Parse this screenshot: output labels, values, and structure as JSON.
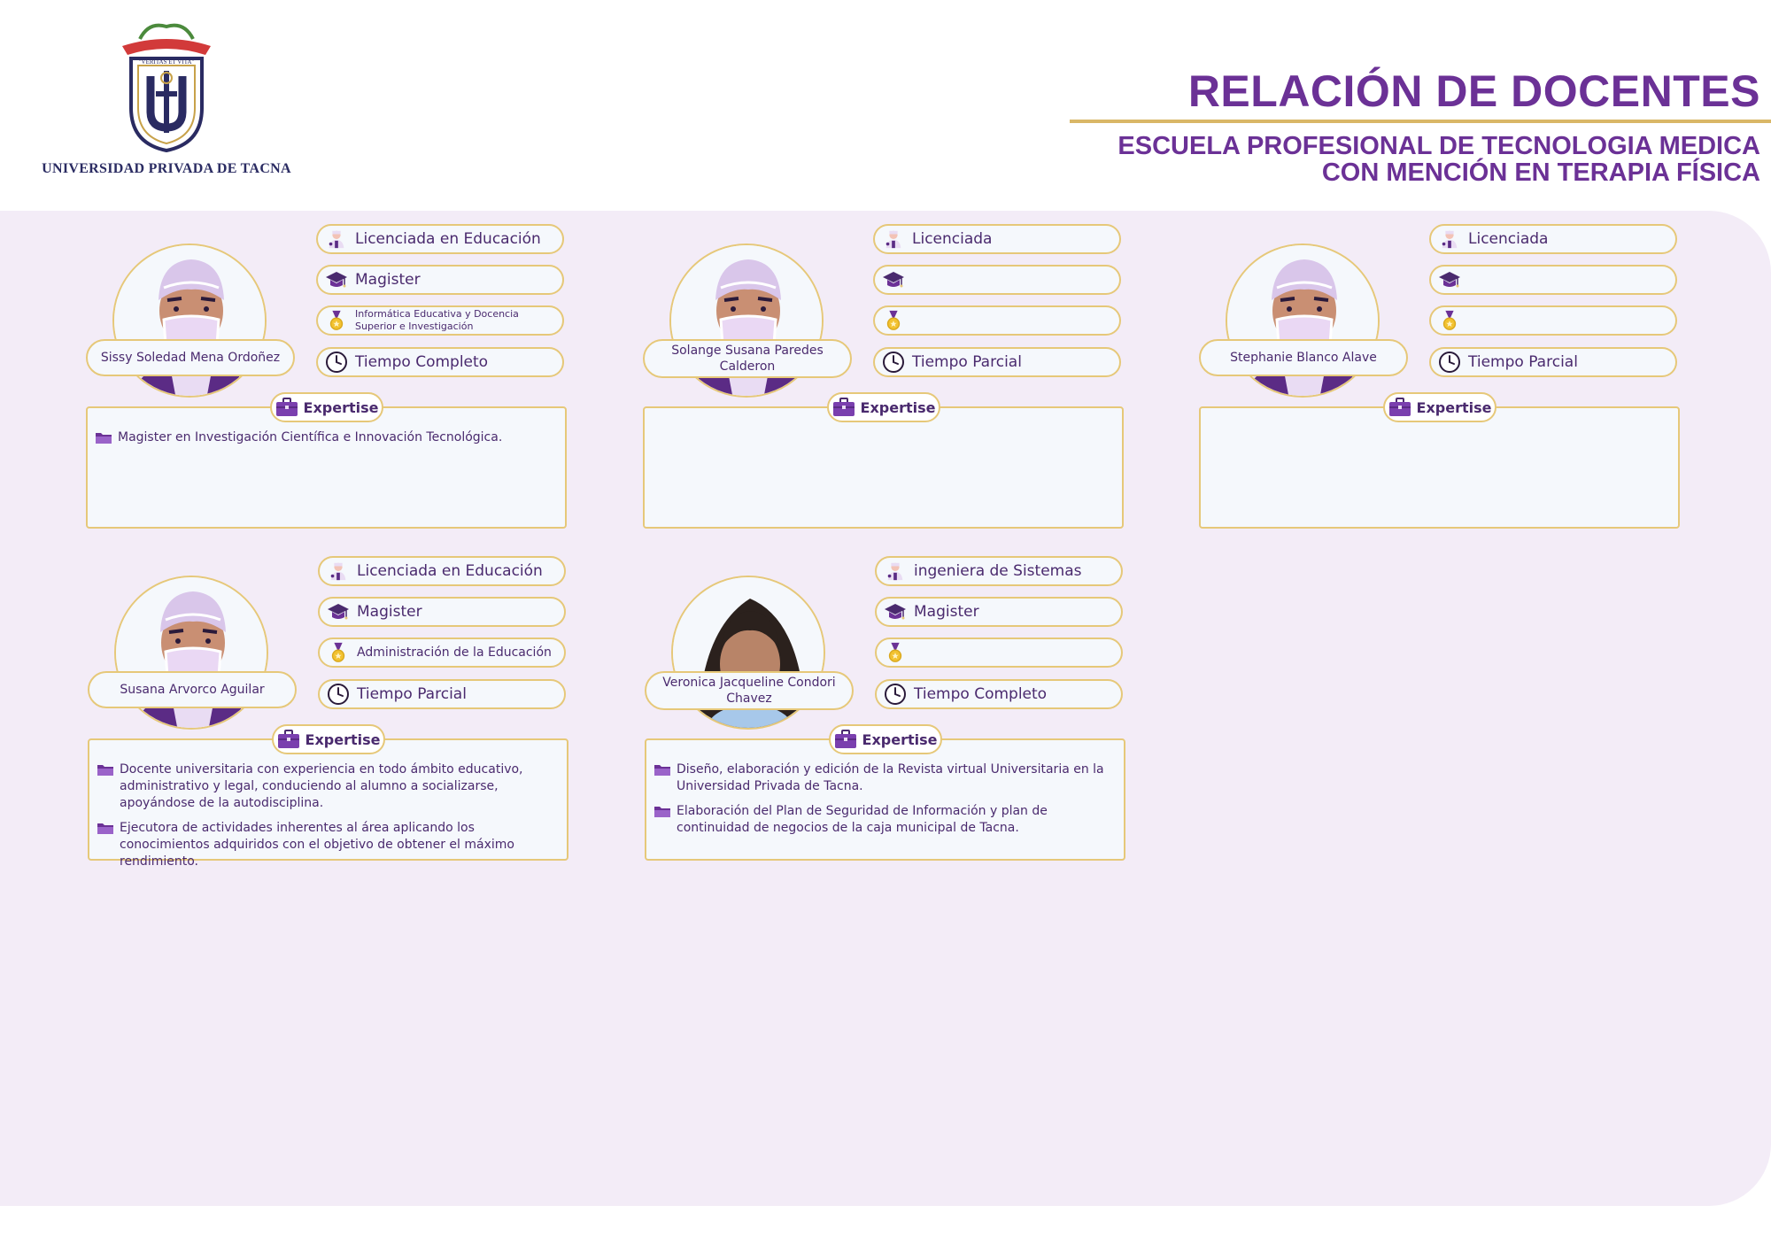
{
  "header": {
    "university": "UNIVERSIDAD PRIVADA DE TACNA",
    "motto": "\"VERITAS ET VITA\"",
    "seal_ring_text": "UNIVERSIDAD PRIVADA DE TACNA",
    "title": "RELACIÓN DE DOCENTES",
    "subtitle_line1": "ESCUELA PROFESIONAL DE TECNOLOGIA MEDICA",
    "subtitle_line2": "CON MENCIÓN EN TERAPIA FÍSICA"
  },
  "expertise_label": "Expertise",
  "colors": {
    "purple": "#6b3196",
    "gold": "#e6c879",
    "panel": "#f3ecf7",
    "navy": "#2a2b62"
  },
  "docentes": [
    {
      "name": "Sissy Soledad Mena Ordoñez",
      "profession": "Licenciada en Educación",
      "degree": "Magister",
      "specialty": "Informática Educativa y Docencia Superior e Investigación",
      "schedule": "Tiempo Completo",
      "expertise": [
        "Magister en Investigación Científica e Innovación Tecnológica."
      ]
    },
    {
      "name": "Solange Susana Paredes Calderon",
      "profession": "Licenciada",
      "degree": "",
      "specialty": "",
      "schedule": "Tiempo Parcial",
      "expertise": []
    },
    {
      "name": "Stephanie Blanco Alave",
      "profession": "Licenciada",
      "degree": "",
      "specialty": "",
      "schedule": "Tiempo Parcial",
      "expertise": []
    },
    {
      "name": "Susana Arvorco Aguilar",
      "profession": "Licenciada en Educación",
      "degree": "Magister",
      "specialty": "Administración de la Educación",
      "schedule": "Tiempo Parcial",
      "expertise": [
        "Docente universitaria con experiencia en todo ámbito educativo, administrativo y legal, conduciendo al alumno a socializarse, apoyándose de la autodisciplina.",
        "Ejecutora de actividades inherentes al área aplicando los conocimientos adquiridos con el objetivo de obtener el máximo rendimiento."
      ]
    },
    {
      "name": "Veronica Jacqueline Condori Chavez",
      "profession": "ingeniera de Sistemas",
      "degree": "Magister",
      "specialty": "",
      "schedule": "Tiempo Completo",
      "expertise": [
        "Diseño, elaboración y edición de la Revista virtual Universitaria en la Universidad Privada de Tacna.",
        "Elaboración del Plan de Seguridad de Información y plan de continuidad de negocios de la caja municipal de Tacna."
      ]
    }
  ]
}
